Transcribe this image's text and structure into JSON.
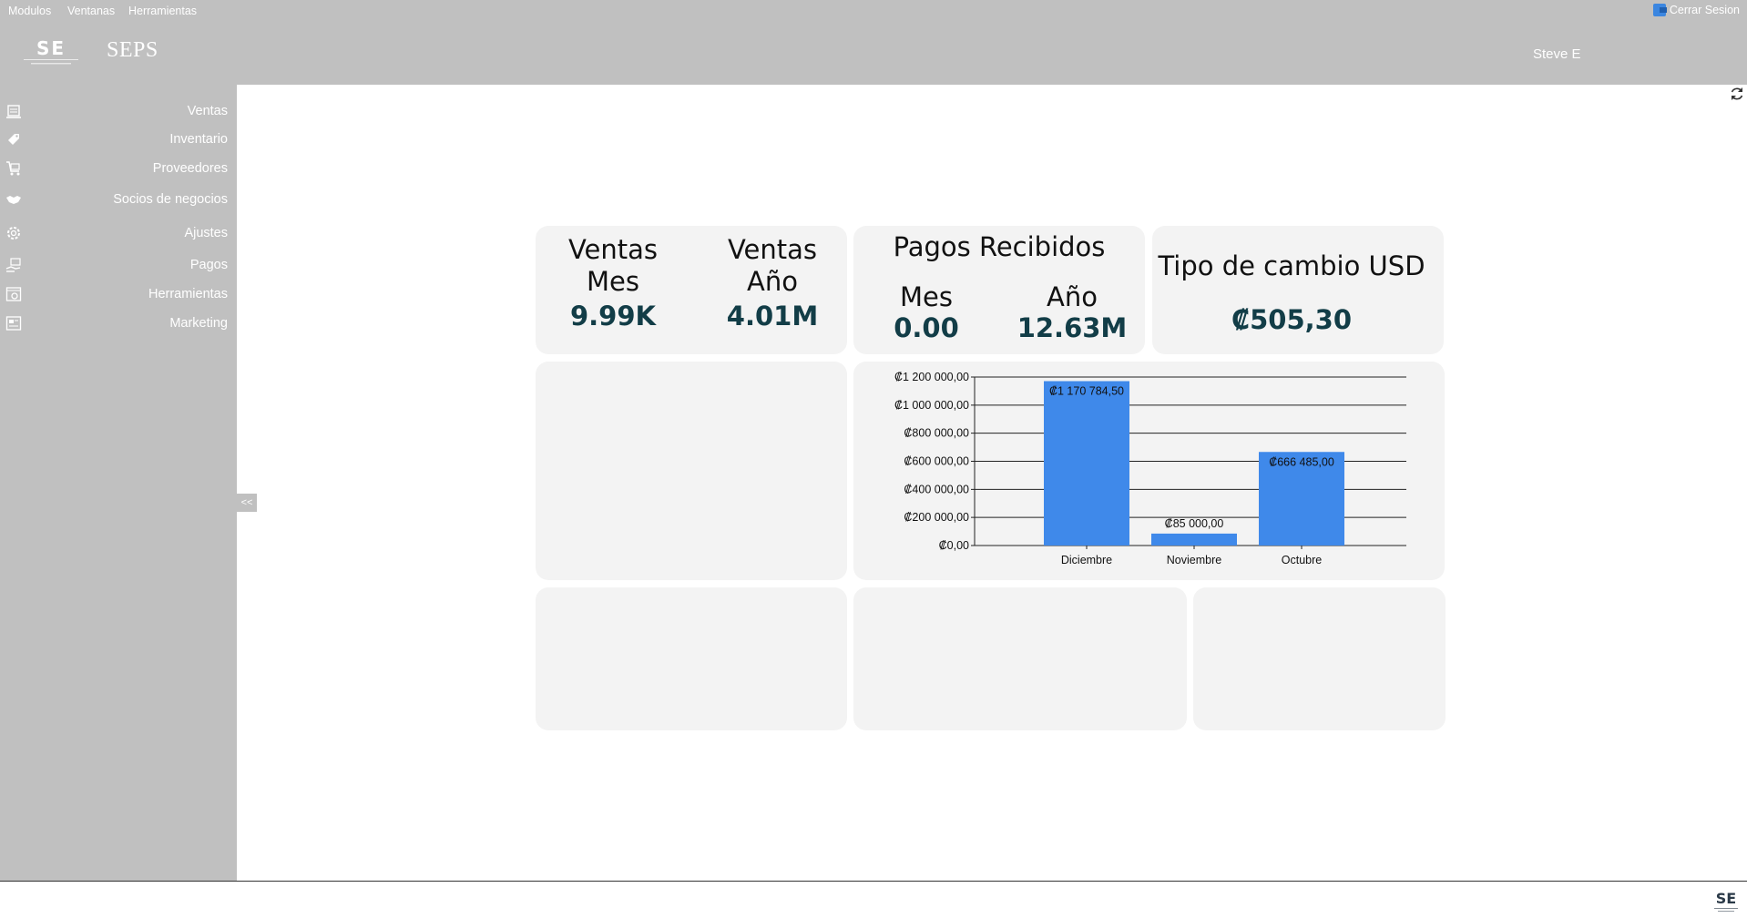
{
  "menubar": {
    "items": [
      "Modulos",
      "Ventanas",
      "Herramientas"
    ],
    "logout_label": "Cerrar Sesion"
  },
  "header": {
    "app_title": "SEPS",
    "user_name": "Steve E"
  },
  "sidebar": {
    "items": [
      {
        "label": "Ventas",
        "icon": "register-icon"
      },
      {
        "label": "Inventario",
        "icon": "tag-icon"
      },
      {
        "label": "Proveedores",
        "icon": "cart-icon"
      },
      {
        "label": "Socios de negocios",
        "icon": "handshake-icon"
      },
      {
        "label": "Ajustes",
        "icon": "gear-icon"
      },
      {
        "label": "Pagos",
        "icon": "payment-icon"
      },
      {
        "label": "Herramientas",
        "icon": "tools-icon"
      },
      {
        "label": "Marketing",
        "icon": "marketing-icon"
      }
    ],
    "collapse_label": "<<"
  },
  "dashboard": {
    "ventas_mes": {
      "label_line1": "Ventas",
      "label_line2": "Mes",
      "value": "9.99K"
    },
    "ventas_anio": {
      "label_line1": "Ventas",
      "label_line2": "Año",
      "value": "4.01M"
    },
    "pagos": {
      "title": "Pagos Recibidos",
      "mes_label": "Mes",
      "mes_value": "0.00",
      "anio_label": "Año",
      "anio_value": "12.63M"
    },
    "tipo_cambio": {
      "title": "Tipo de cambio USD",
      "value": "₡505,30"
    }
  },
  "chart_data": {
    "type": "bar",
    "categories": [
      "Diciembre",
      "Noviembre",
      "Octubre"
    ],
    "values": [
      1170784.5,
      85000.0,
      666485.0
    ],
    "data_labels": [
      "₡1 170 784,50",
      "₡85 000,00",
      "₡666 485,00"
    ],
    "ylim": [
      0,
      1200000
    ],
    "yticks": [
      0,
      200000,
      400000,
      600000,
      800000,
      1000000,
      1200000
    ],
    "ytick_labels": [
      "₡0,00",
      "₡200 000,00",
      "₡400 000,00",
      "₡600 000,00",
      "₡800 000,00",
      "₡1 000 000,00",
      "₡1 200 000,00"
    ],
    "grid": true,
    "bar_color": "#3f89ea"
  },
  "colors": {
    "chrome": "#c0c0c0",
    "card": "#f3f3f3",
    "kpi_value": "#123d47"
  }
}
